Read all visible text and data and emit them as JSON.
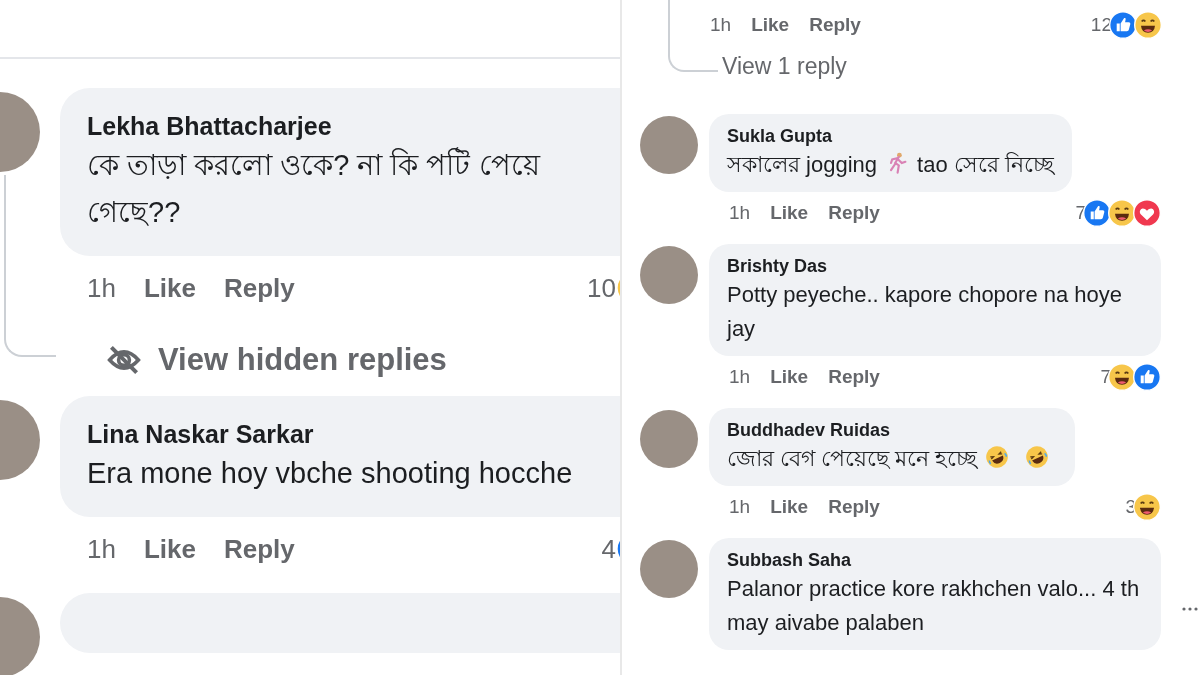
{
  "panels": [
    {
      "kind": "zoomed",
      "items": [
        {
          "kind": "comment",
          "author": "Lekha Bhattacharjee",
          "text": [
            {
              "kind": "text",
              "t": "কে তাড়া করলো ওকে? না কি পটি পেয়ে গেছে??"
            }
          ],
          "time": "1h",
          "like": "Like",
          "reply": "Reply",
          "count": "10",
          "reactions": [
            {
              "kind": "haha"
            }
          ]
        },
        {
          "kind": "replies",
          "text": "View hidden replies",
          "hidden": true
        },
        {
          "kind": "comment",
          "author": "Lina Naskar Sarkar",
          "text": [
            {
              "kind": "text",
              "t": "Era mone hoy vbche shooting hocche"
            }
          ],
          "time": "1h",
          "like": "Like",
          "reply": "Reply",
          "count": "4",
          "reactions": [
            {
              "kind": "like"
            }
          ]
        },
        {
          "kind": "stub"
        }
      ]
    },
    {
      "kind": "normal",
      "items": [
        {
          "kind": "meta",
          "time": "1h",
          "like": "Like",
          "reply": "Reply",
          "count": "12",
          "reactions": [
            {
              "kind": "like"
            },
            {
              "kind": "haha"
            }
          ]
        },
        {
          "kind": "replies",
          "text": "View 1 reply",
          "hidden": false
        },
        {
          "kind": "comment",
          "author": "Sukla Gupta",
          "text": [
            {
              "kind": "text",
              "t": "সকালের jogging"
            },
            {
              "kind": "runner"
            },
            {
              "kind": "text",
              "t": "tao সেরে নিচ্ছে"
            }
          ],
          "time": "1h",
          "like": "Like",
          "reply": "Reply",
          "count": "7",
          "reactions": [
            {
              "kind": "like"
            },
            {
              "kind": "haha"
            },
            {
              "kind": "love"
            }
          ]
        },
        {
          "kind": "comment",
          "author": "Brishty Das",
          "text": [
            {
              "kind": "text",
              "t": "Potty peyeche.. kapore chopore na hoye jay"
            }
          ],
          "time": "1h",
          "like": "Like",
          "reply": "Reply",
          "count": "7",
          "reactions": [
            {
              "kind": "haha"
            },
            {
              "kind": "like"
            }
          ]
        },
        {
          "kind": "comment",
          "author": "Buddhadev Ruidas",
          "text": [
            {
              "kind": "text",
              "t": "জোর বেগ পেয়েছে মনে হচ্ছে"
            },
            {
              "kind": "rofl"
            },
            {
              "kind": "rofl"
            }
          ],
          "time": "1h",
          "like": "Like",
          "reply": "Reply",
          "count": "3",
          "reactions": [
            {
              "kind": "haha"
            }
          ]
        },
        {
          "kind": "comment",
          "author": "Subbash Saha",
          "text": [
            {
              "kind": "text",
              "t": "Palanor practice kore rakhchen valo... 4 th may aivabe palaben"
            }
          ],
          "more": true
        }
      ]
    }
  ]
}
